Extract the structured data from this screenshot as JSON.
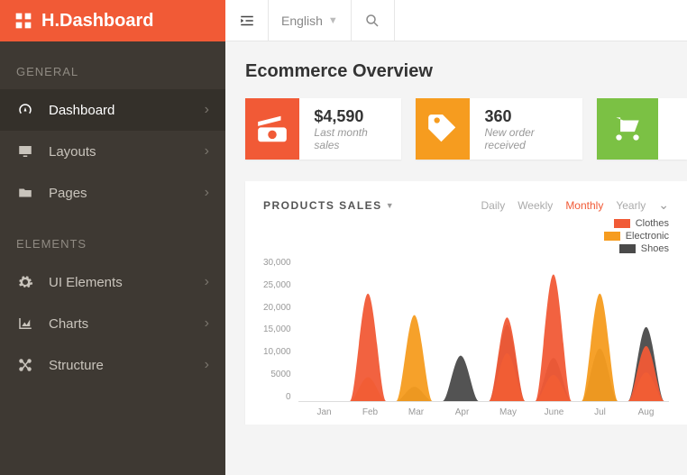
{
  "brand": "H.Dashboard",
  "topbar": {
    "language": "English"
  },
  "sidebar": {
    "sections": [
      {
        "title": "GENERAL",
        "items": [
          {
            "label": "Dashboard",
            "active": true
          },
          {
            "label": "Layouts"
          },
          {
            "label": "Pages"
          }
        ]
      },
      {
        "title": "ELEMENTS",
        "items": [
          {
            "label": "UI Elements"
          },
          {
            "label": "Charts"
          },
          {
            "label": "Structure"
          }
        ]
      }
    ]
  },
  "page": {
    "title": "Ecommerce Overview"
  },
  "stats": [
    {
      "value": "$4,590",
      "sub": "Last month sales",
      "color": "#f15a36"
    },
    {
      "value": "360",
      "sub": "New order received",
      "color": "#f69c1f"
    },
    {
      "value": "",
      "sub": "",
      "color": "#7bc144"
    }
  ],
  "chart": {
    "title": "PRODUCTS SALES",
    "periods": [
      "Daily",
      "Weekly",
      "Monthly",
      "Yearly"
    ],
    "active_period": "Monthly",
    "legend": [
      {
        "name": "Clothes",
        "color": "#f15a36"
      },
      {
        "name": "Electronic",
        "color": "#f69c1f"
      },
      {
        "name": "Shoes",
        "color": "#4a4a4a"
      }
    ],
    "yticks": [
      "30,000",
      "25,000",
      "20,000",
      "15,000",
      "10,000",
      "5000",
      "0"
    ],
    "xticks": [
      "Jan",
      "Feb",
      "Mar",
      "Apr",
      "May",
      "June",
      "Jul",
      "Aug"
    ]
  },
  "chart_data": {
    "type": "area",
    "title": "Products Sales",
    "xlabel": "",
    "ylabel": "",
    "ylim": [
      0,
      30000
    ],
    "categories": [
      "Jan",
      "Feb",
      "Mar",
      "Apr",
      "May",
      "June",
      "Jul",
      "Aug"
    ],
    "series": [
      {
        "name": "Clothes",
        "color": "#f15a36",
        "values": [
          0,
          22500,
          0,
          0,
          17500,
          26500,
          0,
          11500
        ]
      },
      {
        "name": "Electronic",
        "color": "#f69c1f",
        "values": [
          0,
          5000,
          18000,
          0,
          10000,
          5500,
          22500,
          6000
        ]
      },
      {
        "name": "Shoes",
        "color": "#4a4a4a",
        "values": [
          0,
          0,
          3000,
          9500,
          16000,
          9000,
          11000,
          15500
        ]
      }
    ]
  }
}
